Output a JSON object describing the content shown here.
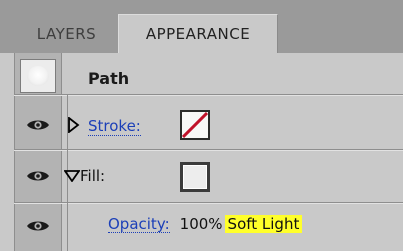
{
  "tabs": [
    {
      "label": "LAYERS"
    },
    {
      "label": "APPEARANCE"
    }
  ],
  "path": {
    "label": "Path"
  },
  "rows": {
    "stroke": {
      "label": "Stroke:"
    },
    "fill": {
      "label": "Fill:"
    },
    "opacity": {
      "label": "Opacity:",
      "value": "100%",
      "blend_mode": "Soft Light"
    }
  },
  "icons": {
    "visibility": "eye-icon",
    "stroke_swatch": "no-color-swatch-icon",
    "fill_swatch": "white-fill-swatch-icon",
    "disclosure_collapsed": "triangle-right-icon",
    "disclosure_expanded": "triangle-down-icon"
  },
  "colors": {
    "link_blue": "#1b3fb8",
    "highlight_yellow": "#ffff2a",
    "none_slash_red": "#c0102a"
  }
}
